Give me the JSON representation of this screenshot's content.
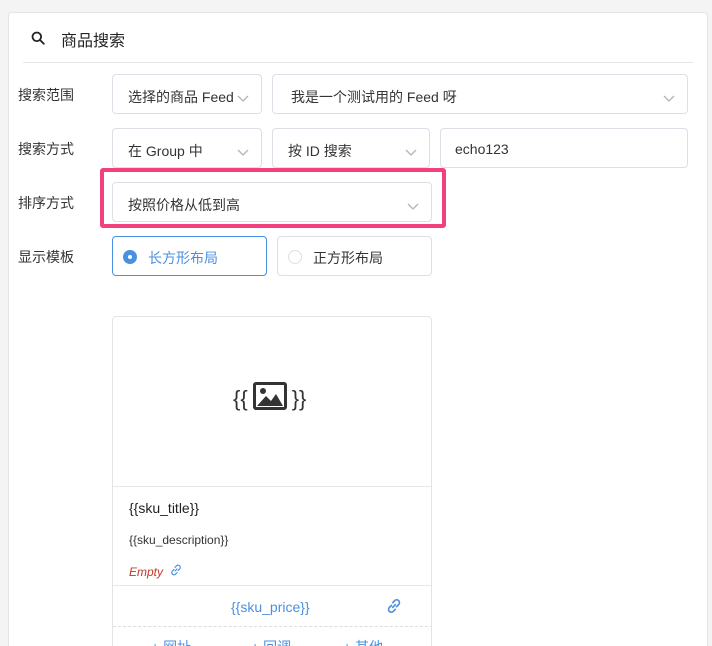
{
  "header": {
    "title": "商品搜索",
    "icon": "search-icon"
  },
  "rows": {
    "scope": {
      "label": "搜索范围",
      "select1": "选择的商品 Feed",
      "select2": "我是一个测试用的 Feed 呀"
    },
    "method": {
      "label": "搜索方式",
      "select1": "在 Group 中",
      "select2": "按 ID 搜索",
      "input_value": "echo123"
    },
    "sort": {
      "label": "排序方式",
      "select": "按照价格从低到高"
    },
    "template": {
      "label": "显示模板",
      "options": [
        "长方形布局",
        "正方形布局"
      ],
      "selected": "长方形布局"
    }
  },
  "card": {
    "image_placeholder_left": "{{",
    "image_placeholder_right": "}}",
    "title": "{{sku_title}}",
    "description": "{{sku_description}}",
    "empty_text": "Empty",
    "price": "{{sku_price}}",
    "actions": [
      "+ 网址",
      "+ 回调",
      "+ 其他"
    ]
  },
  "colors": {
    "accent": "#4a90e2",
    "highlight": "#f23f7e",
    "empty": "#c0392b"
  }
}
